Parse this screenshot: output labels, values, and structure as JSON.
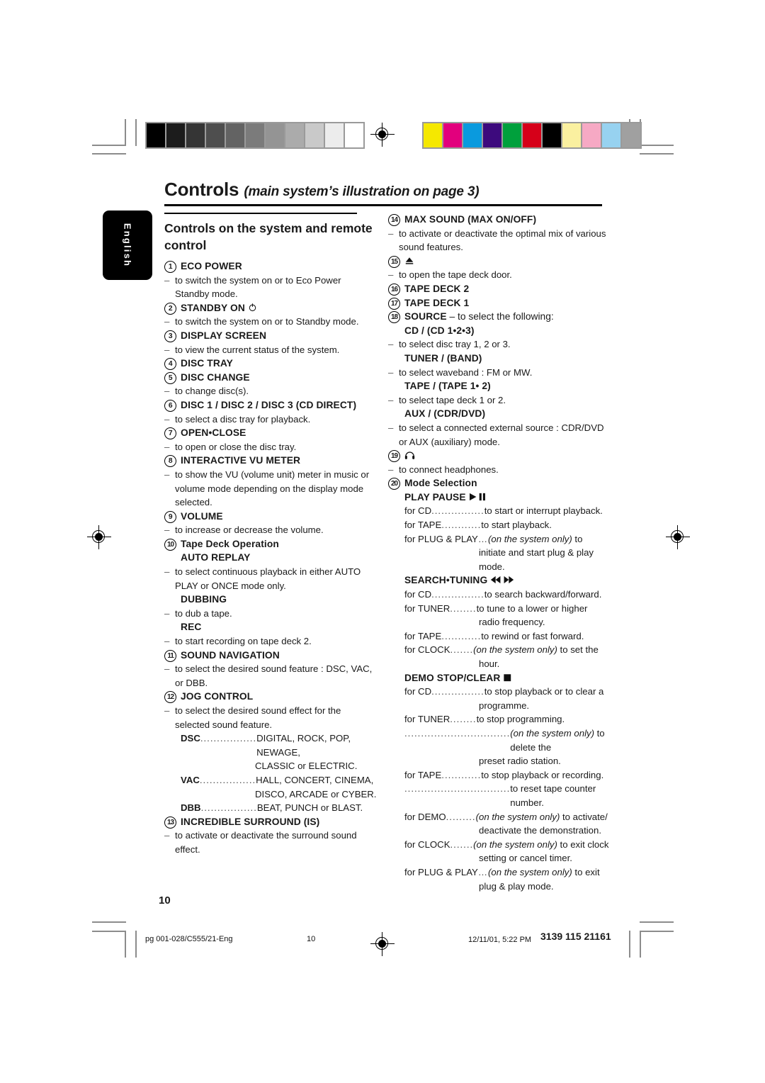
{
  "document": {
    "title_main": "Controls",
    "title_sub": "(main system’s illustration on page 3)",
    "language_tab": "English",
    "page_number": "10"
  },
  "footer": {
    "file": "pg 001-028/C555/21-Eng",
    "page": "10",
    "timestamp": "12/11/01, 5:22 PM",
    "code": "3139 115 21161"
  },
  "colorbars": {
    "grayscale": [
      "#000000",
      "#1c1c1c",
      "#353535",
      "#4e4e4e",
      "#636363",
      "#7b7b7b",
      "#949494",
      "#ababab",
      "#c9c9c9",
      "#ececec",
      "#ffffff"
    ],
    "colors": [
      "#f5e800",
      "#e2007d",
      "#0a9ade",
      "#3d0a7d",
      "#00a03c",
      "#d60019",
      "#000000",
      "#faf0a0",
      "#f6a9c4",
      "#97d2f0",
      "#a0a0a0"
    ]
  },
  "left_column": {
    "section_heading": "Controls on the system and remote control",
    "items": [
      {
        "num": "1",
        "head": "ECO POWER",
        "lines": [
          {
            "type": "dash",
            "text": "to switch the system on or to Eco Power Standby mode."
          }
        ]
      },
      {
        "num": "2",
        "head": "STANDBY ON",
        "icon": "power-icon",
        "lines": [
          {
            "type": "dash",
            "text": "to switch the system on or to Standby mode."
          }
        ]
      },
      {
        "num": "3",
        "head": "DISPLAY SCREEN",
        "lines": [
          {
            "type": "dash",
            "text": "to view the current status of the system."
          }
        ]
      },
      {
        "num": "4",
        "head": "DISC TRAY",
        "lines": []
      },
      {
        "num": "5",
        "head": "DISC CHANGE",
        "lines": [
          {
            "type": "dash",
            "text": "to change disc(s)."
          }
        ]
      },
      {
        "num": "6",
        "head": "DISC 1 / DISC 2 / DISC 3 (CD DIRECT)",
        "lines": [
          {
            "type": "dash",
            "text": "to select a disc tray for playback."
          }
        ]
      },
      {
        "num": "7",
        "head": "OPEN•CLOSE",
        "lines": [
          {
            "type": "dash",
            "text": "to open or close the disc tray."
          }
        ]
      },
      {
        "num": "8",
        "head": "INTERACTIVE VU METER",
        "lines": [
          {
            "type": "dash",
            "text": "to show the VU (volume unit) meter in music or volume mode depending on the display mode selected."
          }
        ]
      },
      {
        "num": "9",
        "head": "VOLUME",
        "lines": [
          {
            "type": "dash",
            "text": "to increase or decrease the volume."
          }
        ]
      },
      {
        "num": "10",
        "head": "Tape Deck Operation",
        "head_weight": "semi",
        "lines": [
          {
            "type": "subhead",
            "text": "AUTO REPLAY"
          },
          {
            "type": "dash",
            "text": "to select continuous playback in either AUTO PLAY or ONCE mode only."
          },
          {
            "type": "subhead",
            "text": "DUBBING"
          },
          {
            "type": "dash",
            "text": "to dub a tape."
          },
          {
            "type": "subhead",
            "text": "REC"
          },
          {
            "type": "dash",
            "text": "to start recording on tape deck 2."
          }
        ]
      },
      {
        "num": "11",
        "head": "SOUND NAVIGATION",
        "lines": [
          {
            "type": "dash",
            "text": "to select the desired sound feature : DSC, VAC, or DBB."
          }
        ]
      },
      {
        "num": "12",
        "head": "JOG CONTROL",
        "lines": [
          {
            "type": "dash",
            "text": "to select the desired sound effect for the selected sound feature."
          },
          {
            "type": "lead",
            "key": "DSC",
            "dots": ".................",
            "value": "DIGITAL, ROCK, POP, NEWAGE,",
            "cont": "CLASSIC or ELECTRIC."
          },
          {
            "type": "lead",
            "key": "VAC",
            "dots": ".................",
            "value": "HALL, CONCERT, CINEMA,",
            "cont": "DISCO, ARCADE or CYBER."
          },
          {
            "type": "lead",
            "key": "DBB",
            "dots": ".................",
            "value": "BEAT, PUNCH or BLAST."
          }
        ]
      },
      {
        "num": "13",
        "head": "INCREDIBLE SURROUND (IS)",
        "lines": [
          {
            "type": "dash",
            "text": "to activate or deactivate the surround sound effect."
          }
        ]
      }
    ]
  },
  "right_column": {
    "items": [
      {
        "num": "14",
        "head": "MAX SOUND (MAX ON/OFF)",
        "lines": [
          {
            "type": "dash",
            "text": "to activate or deactivate the optimal mix of various sound features."
          }
        ]
      },
      {
        "num": "15",
        "head": "",
        "icon": "eject-icon",
        "lines": [
          {
            "type": "dash",
            "text": "to open the tape deck door."
          }
        ]
      },
      {
        "num": "16",
        "head": "TAPE DECK 2",
        "lines": []
      },
      {
        "num": "17",
        "head": "TAPE DECK 1",
        "lines": []
      },
      {
        "num": "18",
        "head": "SOURCE",
        "head_suffix": "– to select the following:",
        "lines": [
          {
            "type": "subhead",
            "text": "CD / (CD 1•2•3)"
          },
          {
            "type": "dash",
            "text": "to select disc tray 1, 2 or 3."
          },
          {
            "type": "subhead",
            "text": "TUNER / (BAND)"
          },
          {
            "type": "dash",
            "text": "to select waveband : FM or MW."
          },
          {
            "type": "subhead",
            "text": "TAPE / (TAPE 1• 2)"
          },
          {
            "type": "dash",
            "text": "to select tape deck 1 or 2."
          },
          {
            "type": "subhead",
            "text": "AUX / (CDR/DVD)"
          },
          {
            "type": "dash",
            "text": "to select a connected external source : CDR/DVD or AUX (auxiliary) mode."
          }
        ]
      },
      {
        "num": "19",
        "head": "",
        "icon": "headphones-icon",
        "lines": [
          {
            "type": "dash",
            "text": "to connect headphones."
          }
        ]
      },
      {
        "num": "20",
        "head": "Mode Selection",
        "head_weight": "semi",
        "lines": [
          {
            "type": "subhead",
            "text": "PLAY PAUSE",
            "icon": "play-pause-icon"
          },
          {
            "type": "lead",
            "key": "for CD",
            "key_norm": true,
            "dots": "................",
            "value": "to start or interrupt playback."
          },
          {
            "type": "lead",
            "key": "for TAPE",
            "key_norm": true,
            "dots": "............",
            "value": "to start playback."
          },
          {
            "type": "lead",
            "key": "for PLUG & PLAY",
            "key_norm": true,
            "dots": "…",
            "value_italic": "(on the system only)",
            "value": " to",
            "cont": "initiate and start plug & play",
            "cont2": "mode."
          },
          {
            "type": "subhead",
            "text": "SEARCH•TUNING",
            "icon": "search-tuning-icon"
          },
          {
            "type": "lead",
            "key": "for CD",
            "key_norm": true,
            "dots": "................",
            "value": "to search backward/forward."
          },
          {
            "type": "lead",
            "key": "for TUNER",
            "key_norm": true,
            "dots": "........",
            "value": "to tune to a lower or higher",
            "cont": "radio frequency."
          },
          {
            "type": "lead",
            "key": "for TAPE",
            "key_norm": true,
            "dots": "............",
            "value": "to rewind or fast forward."
          },
          {
            "type": "lead",
            "key": "for CLOCK",
            "key_norm": true,
            "dots": ".......",
            "value_italic": "(on the system only)",
            "value": " to set the",
            "cont": "hour."
          },
          {
            "type": "subhead",
            "text": "DEMO STOP/CLEAR",
            "icon": "stop-icon"
          },
          {
            "type": "lead",
            "key": "for CD",
            "key_norm": true,
            "dots": "................",
            "value": "to stop playback or to clear a",
            "cont": "programme."
          },
          {
            "type": "lead",
            "key": "for TUNER",
            "key_norm": true,
            "dots": "........",
            "value": "to stop programming."
          },
          {
            "type": "lead",
            "key": "",
            "key_norm": true,
            "dots": "................................",
            "value_italic": "(on the system only)",
            "value": " to delete the",
            "cont": "preset radio station."
          },
          {
            "type": "lead",
            "key": "for TAPE",
            "key_norm": true,
            "dots": "............",
            "value": "to stop playback or recording."
          },
          {
            "type": "lead",
            "key": "",
            "key_norm": true,
            "dots": "................................",
            "value": "to reset tape counter number."
          },
          {
            "type": "lead",
            "key": "for DEMO",
            "key_norm": true,
            "dots": ".........",
            "value_italic": "(on the system only)",
            "value": " to activate/",
            "cont": "deactivate the demonstration."
          },
          {
            "type": "lead",
            "key": "for CLOCK",
            "key_norm": true,
            "dots": ".......",
            "value_italic": "(on the system only)",
            "value": " to exit clock",
            "cont": "setting or cancel timer."
          },
          {
            "type": "lead",
            "key": "for PLUG & PLAY",
            "key_norm": true,
            "dots": "…",
            "value_italic": "(on the system only)",
            "value": " to exit",
            "cont": "plug & play mode."
          }
        ]
      }
    ]
  }
}
